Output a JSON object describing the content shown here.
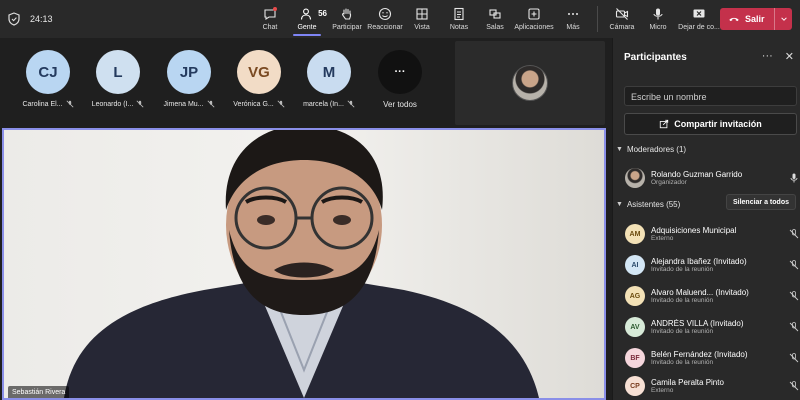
{
  "topbar": {
    "timer": "24:13",
    "tools": [
      {
        "label": "Chat",
        "icon": "chat-icon"
      },
      {
        "label": "Gente",
        "icon": "people-icon",
        "count": "56",
        "active": true
      },
      {
        "label": "Participar",
        "icon": "raise-hand-icon"
      },
      {
        "label": "Reaccionar",
        "icon": "react-icon"
      },
      {
        "label": "Vista",
        "icon": "view-icon"
      },
      {
        "label": "Notas",
        "icon": "notes-icon"
      },
      {
        "label": "Salas",
        "icon": "rooms-icon"
      },
      {
        "label": "Aplicaciones",
        "icon": "apps-icon"
      },
      {
        "label": "Más",
        "icon": "more-icon"
      },
      {
        "label": "Cámara",
        "icon": "camera-off-icon"
      },
      {
        "label": "Micro",
        "icon": "mic-icon"
      },
      {
        "label": "Dejar de co...",
        "icon": "stop-share-icon"
      }
    ],
    "leave_label": "Salir"
  },
  "gallery": {
    "attendees": [
      {
        "initials": "CJ",
        "name": "Carolina El...",
        "color": "#b9d6f2"
      },
      {
        "initials": "L",
        "name": "Leonardo (I...",
        "color": "#cfe0f0"
      },
      {
        "initials": "JP",
        "name": "Jimena Mu...",
        "color": "#b9d6f2"
      },
      {
        "initials": "VG",
        "name": "Verónica G...",
        "color": "#f2dcc6"
      },
      {
        "initials": "M",
        "name": "marcela (In...",
        "color": "#c9dcf0"
      }
    ],
    "see_all": {
      "glyph": "···",
      "label": "Ver todos"
    }
  },
  "video": {
    "speaker_name": "Sebastián Rivera"
  },
  "panel": {
    "title": "Participantes",
    "search_placeholder": "Escribe un nombre",
    "invite_label": "Compartir invitación",
    "moderators_label": "Moderadores (1)",
    "moderator": {
      "name": "Rolando Guzman Garrido",
      "role": "Organizador"
    },
    "attendees_label": "Asistentes (55)",
    "mute_all_label": "Silenciar a todos",
    "attendees": [
      {
        "initials": "AM",
        "name": "Adquisiciones Municipal",
        "role": "Externo",
        "bg": "#f3e1b6",
        "fg": "#6b4b0e"
      },
      {
        "initials": "AI",
        "name": "Alejandra Ibañez (Invitado)",
        "role": "Invitado de la reunión",
        "bg": "#d3e6f5",
        "fg": "#2a4a6b"
      },
      {
        "initials": "AG",
        "name": "Alvaro Maluend... (Invitado)",
        "role": "Invitado de la reunión",
        "bg": "#f3e1b6",
        "fg": "#6b4b0e"
      },
      {
        "initials": "AV",
        "name": "ANDRÉS VILLA (Invitado)",
        "role": "Invitado de la reunión",
        "bg": "#d7ead8",
        "fg": "#2b5a2f"
      },
      {
        "initials": "BF",
        "name": "Belén Fernández (Invitado)",
        "role": "Invitado de la reunión",
        "bg": "#f5d6dc",
        "fg": "#7a2a3a"
      },
      {
        "initials": "CP",
        "name": "Camila Peralta Pinto",
        "role": "Externo",
        "bg": "#f7e0d4",
        "fg": "#7a3c1e"
      }
    ]
  },
  "colors": {
    "accent": "#7f85f5",
    "leave": "#c4314b"
  }
}
